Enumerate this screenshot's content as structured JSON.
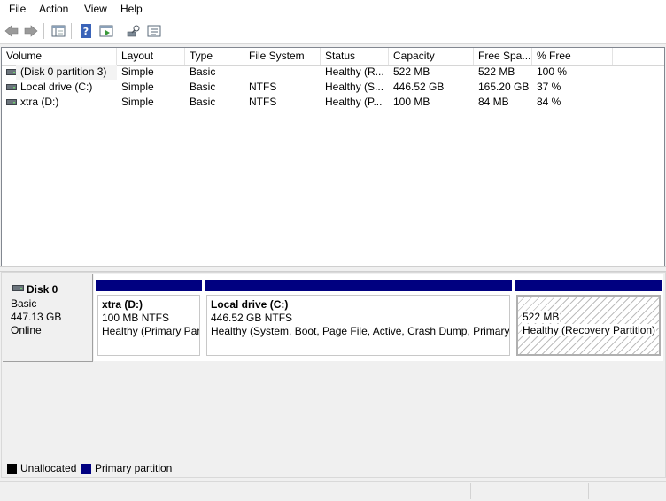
{
  "menu": [
    "File",
    "Action",
    "View",
    "Help"
  ],
  "toolbar": {
    "buttons": [
      "back-arrow",
      "forward-arrow",
      "show-hide-console-tree",
      "help",
      "properties",
      "connect-disk",
      "disk-list-view"
    ]
  },
  "volume_list": {
    "columns": [
      "Volume",
      "Layout",
      "Type",
      "File System",
      "Status",
      "Capacity",
      "Free Spa...",
      "% Free"
    ],
    "rows": [
      {
        "volume": "(Disk 0 partition 3)",
        "layout": "Simple",
        "type": "Basic",
        "fs": "",
        "status": "Healthy (R...",
        "capacity": "522 MB",
        "free": "522 MB",
        "pct": "100 %"
      },
      {
        "volume": "Local drive (C:)",
        "layout": "Simple",
        "type": "Basic",
        "fs": "NTFS",
        "status": "Healthy (S...",
        "capacity": "446.52 GB",
        "free": "165.20 GB",
        "pct": "37 %"
      },
      {
        "volume": "xtra (D:)",
        "layout": "Simple",
        "type": "Basic",
        "fs": "NTFS",
        "status": "Healthy (P...",
        "capacity": "100 MB",
        "free": "84 MB",
        "pct": "84 %"
      }
    ]
  },
  "disk": {
    "name": "Disk 0",
    "type": "Basic",
    "size": "447.13 GB",
    "state": "Online",
    "partitions": [
      {
        "label": "xtra  (D:)",
        "detail": "100 MB NTFS",
        "status": "Healthy (Primary Partition)"
      },
      {
        "label": "Local drive  (C:)",
        "detail": "446.52 GB NTFS",
        "status": "Healthy (System, Boot, Page File, Active, Crash Dump, Primary Partition)"
      },
      {
        "label": "",
        "detail": "522 MB",
        "status": "Healthy (Recovery Partition)"
      }
    ]
  },
  "legend": {
    "unallocated": "Unallocated",
    "primary": "Primary partition",
    "colors": {
      "unallocated": "#000000",
      "primary": "#000080"
    }
  }
}
